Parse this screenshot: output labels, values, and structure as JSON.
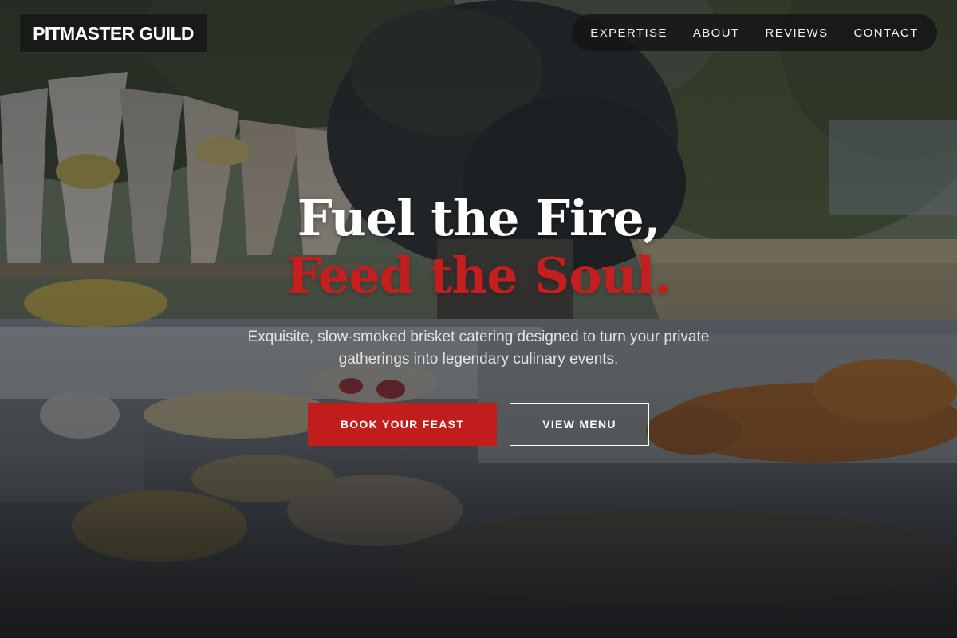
{
  "brand": {
    "name": "PITMASTER GUILD"
  },
  "nav": {
    "items": [
      {
        "label": "EXPERTISE"
      },
      {
        "label": "ABOUT"
      },
      {
        "label": "REVIEWS"
      },
      {
        "label": "CONTACT"
      }
    ]
  },
  "hero": {
    "headline_line1": "Fuel the Fire,",
    "headline_line2": "Feed the Soul.",
    "subtitle": "Exquisite, slow-smoked brisket catering designed to turn your private gatherings into legendary culinary events.",
    "primary_cta": "BOOK YOUR FEAST",
    "secondary_cta": "VIEW MENU"
  },
  "colors": {
    "accent_red": "#c11d1d",
    "headline_white": "#ffffff",
    "nav_background": "#141414"
  },
  "icons": {
    "background": "catering-buffet-photo"
  }
}
